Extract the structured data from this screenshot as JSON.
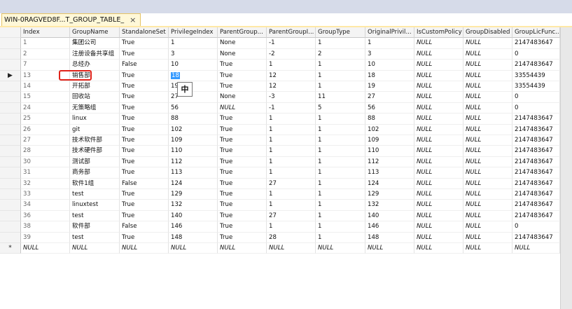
{
  "tab": {
    "title": "WIN-0RAGVED8F...T_GROUP_TABLE_",
    "close_glyph": "×"
  },
  "columns": [
    "Index",
    "GroupName",
    "StandaloneSet",
    "PrivilegeIndex",
    "ParentGroup...",
    "ParentGroupI...",
    "GroupType",
    "OriginalPrivil...",
    "IsCustomPolicy",
    "GroupDisabled",
    "GroupLicFunc..."
  ],
  "rows": [
    [
      "1",
      "集团公司",
      "True",
      "1",
      "None",
      "-1",
      "1",
      "1",
      "NULL",
      "NULL",
      "2147483647"
    ],
    [
      "2",
      "注册设备共享组",
      "True",
      "3",
      "None",
      "-2",
      "2",
      "3",
      "NULL",
      "NULL",
      "0"
    ],
    [
      "7",
      "总经办",
      "False",
      "10",
      "True",
      "1",
      "1",
      "10",
      "NULL",
      "NULL",
      "2147483647"
    ],
    [
      "13",
      "销售部",
      "True",
      "18",
      "True",
      "12",
      "1",
      "18",
      "NULL",
      "NULL",
      "33554439"
    ],
    [
      "14",
      "开拓部",
      "True",
      "19",
      "True",
      "12",
      "1",
      "19",
      "NULL",
      "NULL",
      "33554439"
    ],
    [
      "15",
      "回收站",
      "True",
      "27",
      "None",
      "-3",
      "11",
      "27",
      "NULL",
      "NULL",
      "0"
    ],
    [
      "24",
      "无策略组",
      "True",
      "56",
      "NULL",
      "-1",
      "5",
      "56",
      "NULL",
      "NULL",
      "0"
    ],
    [
      "25",
      "linux",
      "True",
      "88",
      "True",
      "1",
      "1",
      "88",
      "NULL",
      "NULL",
      "2147483647"
    ],
    [
      "26",
      "git",
      "True",
      "102",
      "True",
      "1",
      "1",
      "102",
      "NULL",
      "NULL",
      "2147483647"
    ],
    [
      "27",
      "技术软件部",
      "True",
      "109",
      "True",
      "1",
      "1",
      "109",
      "NULL",
      "NULL",
      "2147483647"
    ],
    [
      "28",
      "技术硬件部",
      "True",
      "110",
      "True",
      "1",
      "1",
      "110",
      "NULL",
      "NULL",
      "2147483647"
    ],
    [
      "30",
      "测试部",
      "True",
      "112",
      "True",
      "1",
      "1",
      "112",
      "NULL",
      "NULL",
      "2147483647"
    ],
    [
      "31",
      "商务部",
      "True",
      "113",
      "True",
      "1",
      "1",
      "113",
      "NULL",
      "NULL",
      "2147483647"
    ],
    [
      "32",
      "软件1组",
      "False",
      "124",
      "True",
      "27",
      "1",
      "124",
      "NULL",
      "NULL",
      "2147483647"
    ],
    [
      "33",
      "test",
      "True",
      "129",
      "True",
      "1",
      "1",
      "129",
      "NULL",
      "NULL",
      "2147483647"
    ],
    [
      "34",
      "linuxtest",
      "True",
      "132",
      "True",
      "1",
      "1",
      "132",
      "NULL",
      "NULL",
      "2147483647"
    ],
    [
      "36",
      "test",
      "True",
      "140",
      "True",
      "27",
      "1",
      "140",
      "NULL",
      "NULL",
      "2147483647"
    ],
    [
      "38",
      "软件部",
      "False",
      "146",
      "True",
      "1",
      "1",
      "146",
      "NULL",
      "NULL",
      "0"
    ],
    [
      "39",
      "test",
      "True",
      "148",
      "True",
      "28",
      "1",
      "148",
      "NULL",
      "NULL",
      "2147483647"
    ],
    [
      "NULL",
      "NULL",
      "NULL",
      "NULL",
      "NULL",
      "NULL",
      "NULL",
      "NULL",
      "NULL",
      "NULL",
      "NULL"
    ]
  ],
  "row_markers": {
    "current": "▶",
    "new": "*"
  },
  "current_row_index": 3,
  "new_row_index": 19,
  "ime_indicator": "中"
}
